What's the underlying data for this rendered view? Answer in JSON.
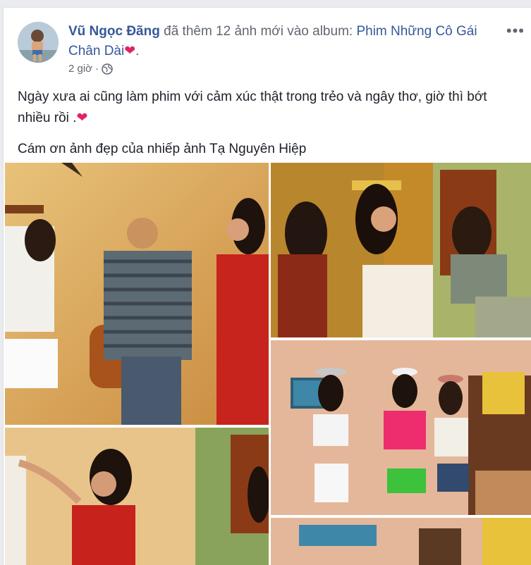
{
  "post": {
    "author": "Vũ Ngọc Đãng",
    "action_text": " đã thêm 12 ảnh mới vào album: ",
    "album_title": "Phim Những Cô Gái Chân Dài",
    "heart": "❤",
    "trailing": ".",
    "timestamp": "2 giờ",
    "separator": "·",
    "privacy_icon": "globe-icon",
    "more_icon": "•••",
    "body": {
      "line1": "Ngày xưa ai cũng làm phim với cảm xúc thật trong trẻo và ngây thơ, giờ thì bớt nhiều rồi .",
      "line1_heart": "❤",
      "line2": "Cám ơn ảnh đẹp của nhiếp ảnh Tạ Nguyên Hiệp"
    }
  },
  "colors": {
    "link": "#365899",
    "meta": "#616770",
    "text": "#1d2129",
    "heart": "#e0245e",
    "background": "#e9ebee"
  },
  "photos": [
    {
      "name": "photo-1",
      "alt": "Film still: man with two women in a warm room"
    },
    {
      "name": "photo-2",
      "alt": "Film still: woman balancing a book on her head"
    },
    {
      "name": "photo-3",
      "alt": "Film still: three women balancing plates on heads"
    },
    {
      "name": "photo-4",
      "alt": "Film still: woman in red top"
    },
    {
      "name": "photo-5",
      "alt": "Film still: room with window and shelves"
    }
  ]
}
